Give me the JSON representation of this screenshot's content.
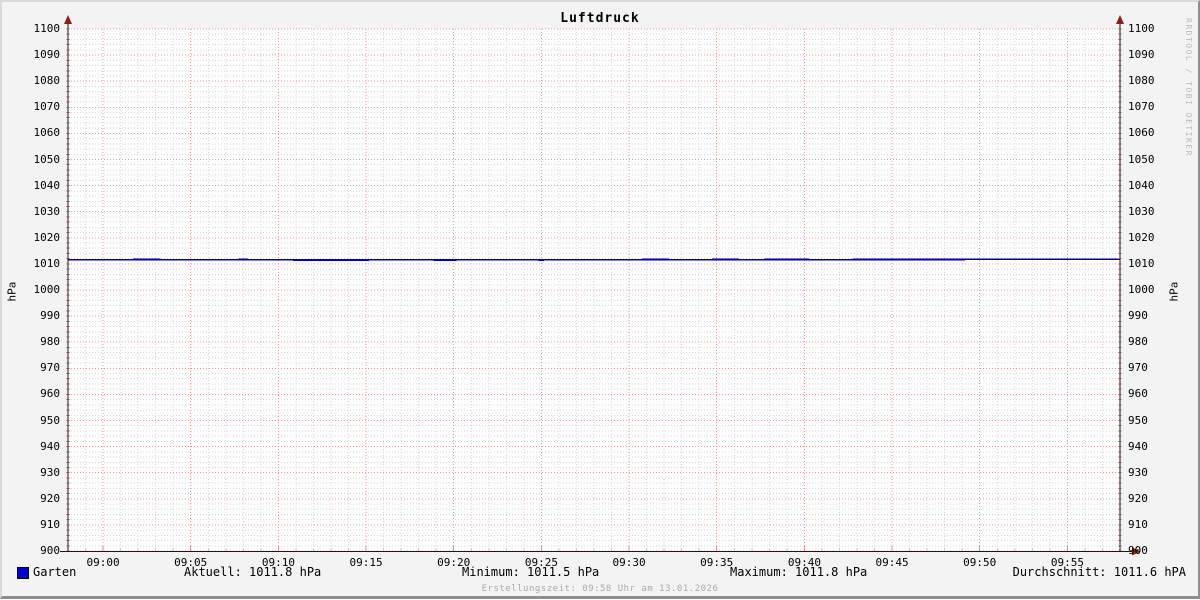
{
  "title": "Luftdruck",
  "axis": {
    "y_label_left": "hPa",
    "y_label_right": "hPa"
  },
  "legend": {
    "series_label": "Garten",
    "aktuell": "Aktuell: 1011.8 hPa",
    "minimum": "Minimum: 1011.5 hPa",
    "maximum": "Maximum: 1011.8 hPa",
    "durchschnitt": "Durchschnitt: 1011.6 hPA"
  },
  "footer": "Erstellungszeit: 09:58 Uhr am 13.01.2026",
  "watermark": "RRDTOOL / TOBI OETIKER",
  "colors": {
    "series": "#0000cc",
    "legend_swatch": "#0000cc",
    "major_grid": "#ef9a9a",
    "minor_grid": "#d9d9d9",
    "axis": "#1a1a1a",
    "arrow": "#8d1f12",
    "minor_tick": "#e09090",
    "canvas": "#fdfdfd"
  },
  "chart_data": {
    "type": "line",
    "title": "Luftdruck",
    "xlabel": "",
    "ylabel": "hPa",
    "ylim": [
      900,
      1100
    ],
    "y_tick_step": 10,
    "y_minor_step": 2,
    "x_start": "08:58",
    "x_end": "09:58",
    "x_total_minutes": 60,
    "x_minor_step_minutes": 1,
    "x_tick_minutes": [
      2,
      7,
      12,
      17,
      22,
      27,
      32,
      37,
      42,
      47,
      52,
      57
    ],
    "x_tick_labels": [
      "09:00",
      "09:05",
      "09:10",
      "09:15",
      "09:20",
      "09:25",
      "09:30",
      "09:35",
      "09:40",
      "09:45",
      "09:50",
      "09:55"
    ],
    "grid": true,
    "legend_position": "bottom",
    "series": [
      {
        "name": "Garten",
        "color": "#0000cc",
        "values": [
          1011.6,
          1011.6,
          1011.6,
          1011.6,
          1011.7,
          1011.7,
          1011.6,
          1011.6,
          1011.6,
          1011.6,
          1011.7,
          1011.6,
          1011.6,
          1011.5,
          1011.5,
          1011.5,
          1011.5,
          1011.5,
          1011.6,
          1011.6,
          1011.6,
          1011.5,
          1011.5,
          1011.6,
          1011.6,
          1011.6,
          1011.6,
          1011.5,
          1011.6,
          1011.6,
          1011.6,
          1011.6,
          1011.6,
          1011.7,
          1011.7,
          1011.6,
          1011.6,
          1011.7,
          1011.7,
          1011.6,
          1011.7,
          1011.7,
          1011.7,
          1011.6,
          1011.6,
          1011.7,
          1011.7,
          1011.7,
          1011.7,
          1011.7,
          1011.7,
          1011.7,
          1011.8,
          1011.8,
          1011.8,
          1011.8,
          1011.8,
          1011.8,
          1011.8,
          1011.8,
          1011.8
        ]
      }
    ],
    "stats": {
      "aktuell": 1011.8,
      "minimum": 1011.5,
      "maximum": 1011.8,
      "durchschnitt": 1011.6
    }
  }
}
